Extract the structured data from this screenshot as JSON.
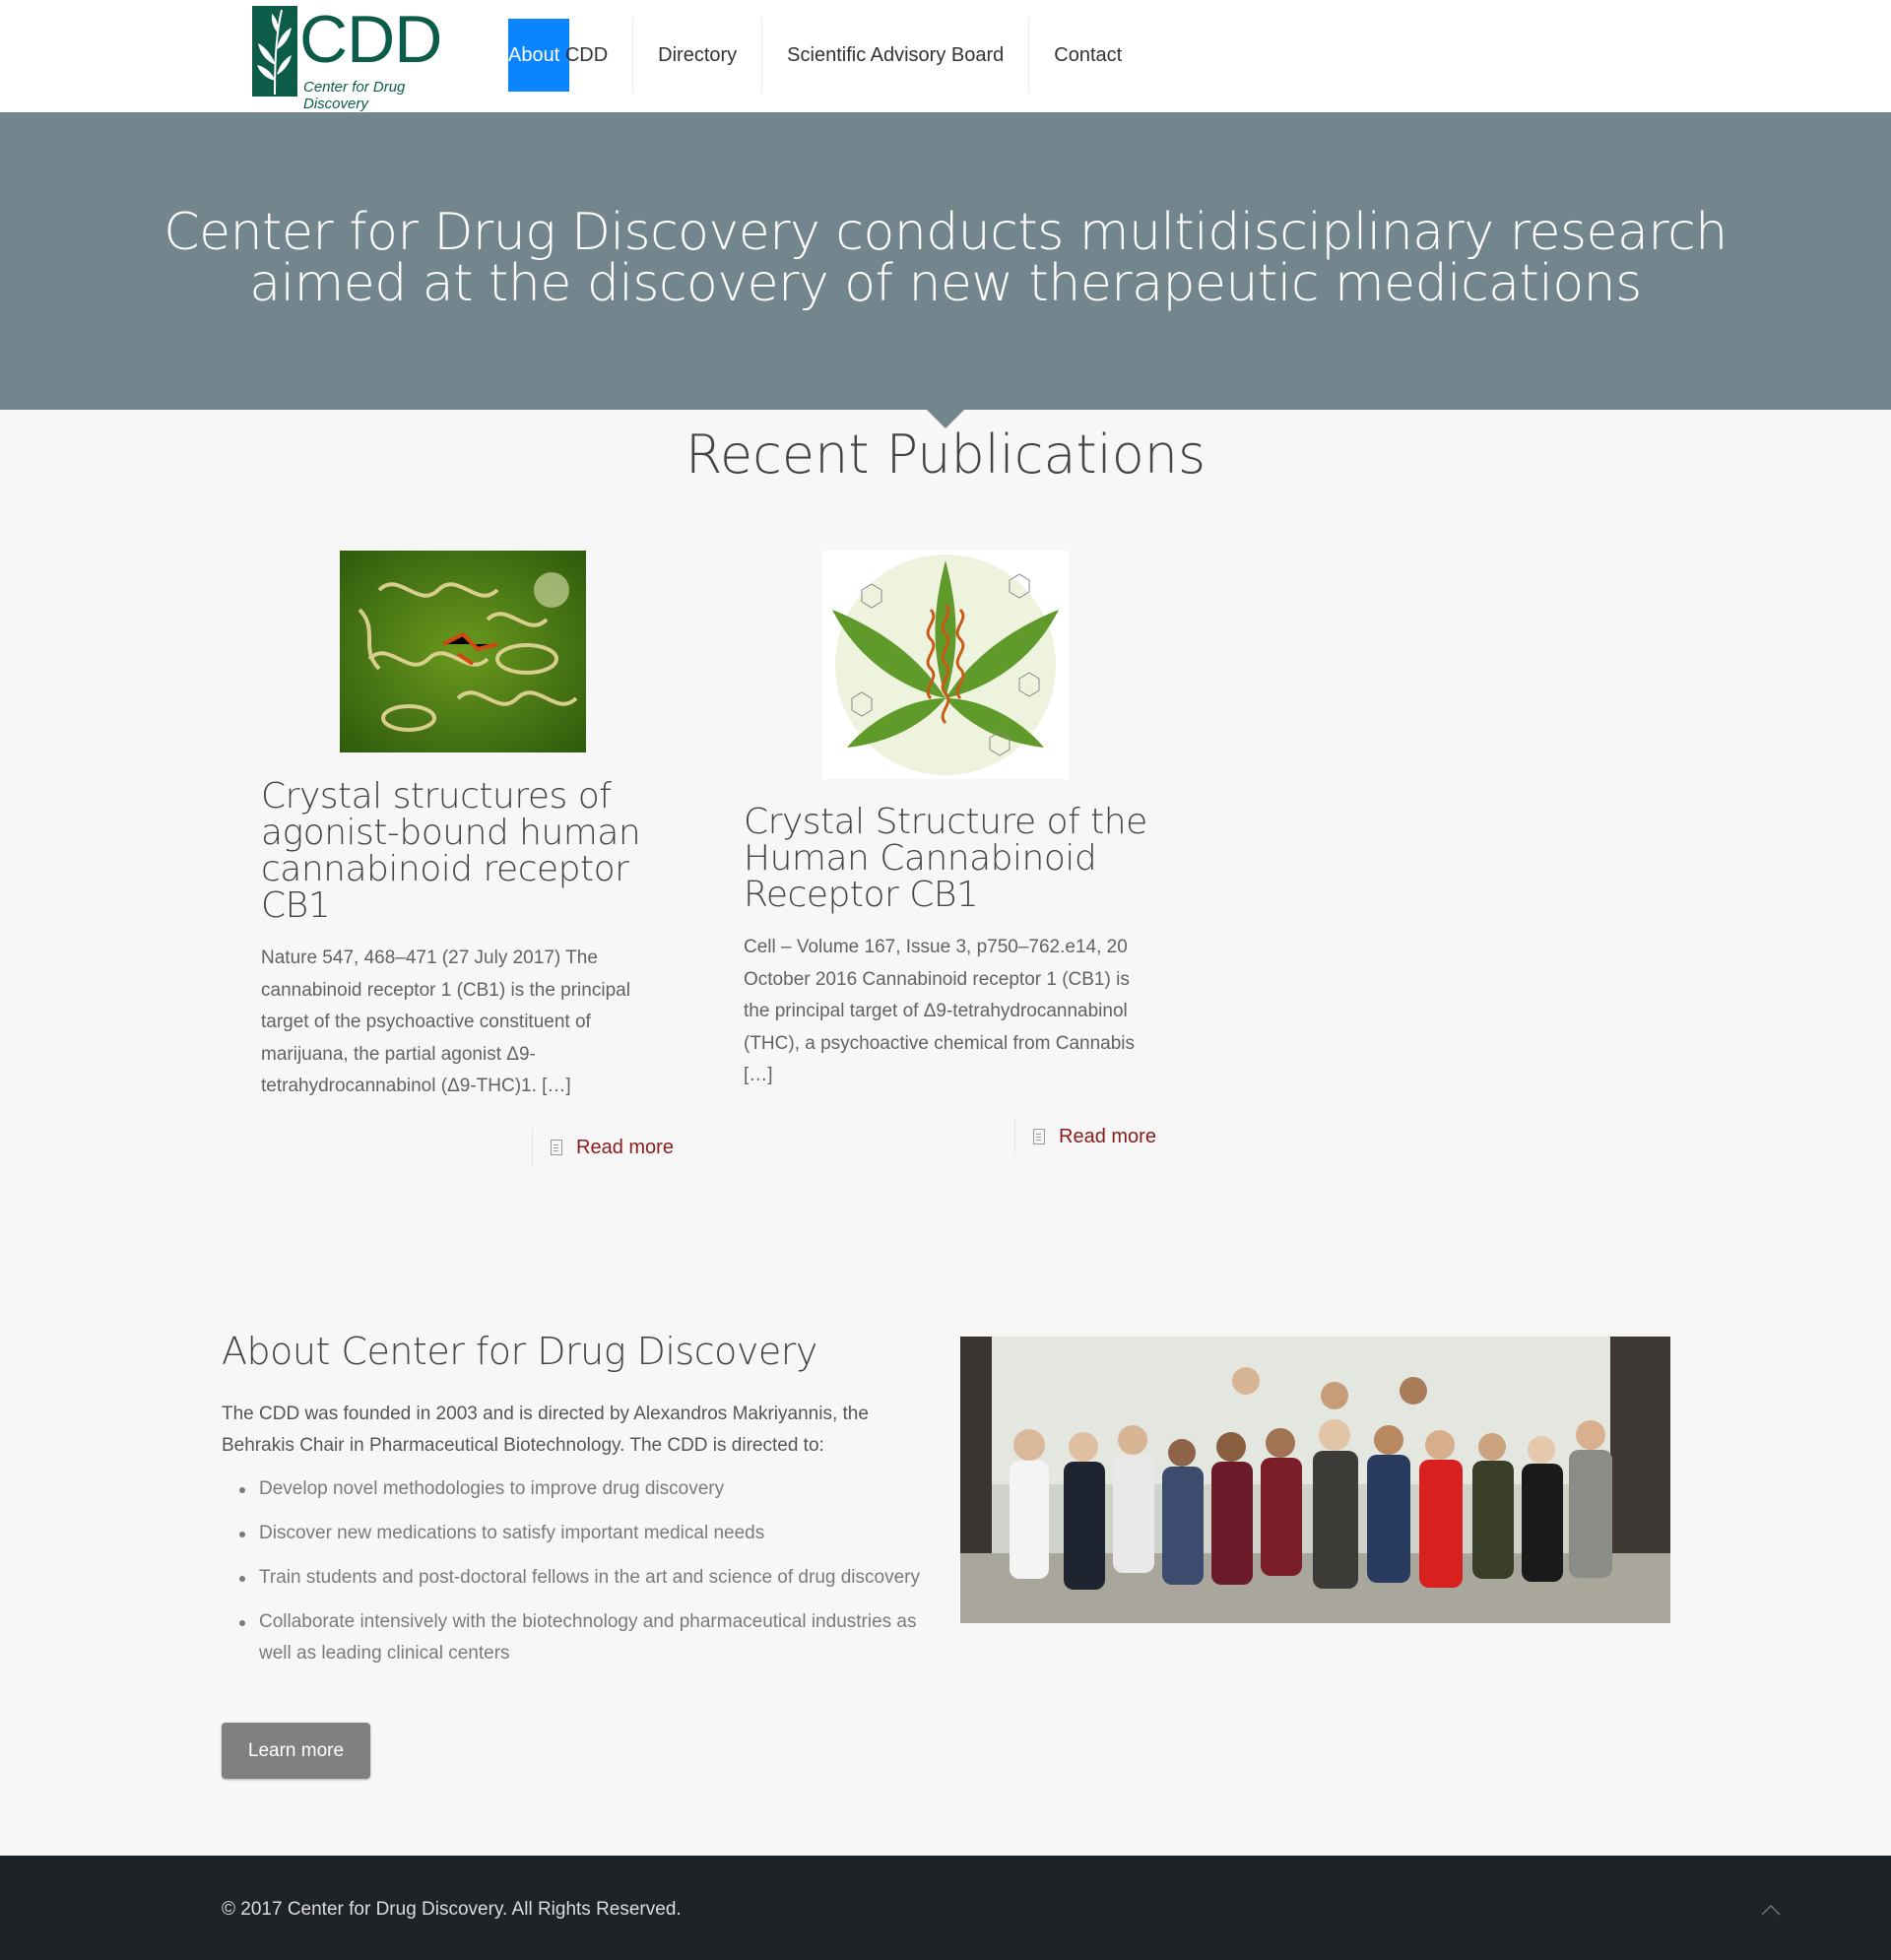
{
  "colors": {
    "hero_bg": "#74868d",
    "nav_highlight": "#0a84ff",
    "logo_green": "#0d5c4a",
    "readmore": "#8b1a1a",
    "footer_bg": "#1d2327",
    "button_bg": "#808080"
  },
  "header": {
    "logo": {
      "big_text": "CDD",
      "small_text": "Center for Drug Discovery",
      "icon": "leaf-logo-icon"
    },
    "nav": [
      {
        "label_highlight": "About",
        "label_rest": " CDD"
      },
      {
        "label": "Directory"
      },
      {
        "label": "Scientific Advisory Board"
      },
      {
        "label": "Contact"
      }
    ]
  },
  "hero": {
    "line1": "Center for Drug Discovery conducts multidisciplinary research",
    "line2": "aimed at the discovery of new therapeutic medications"
  },
  "publications": {
    "title": "Recent Publications",
    "items": [
      {
        "title": "Crystal structures of agonist-bound human cannabinoid receptor CB1",
        "excerpt": "Nature 547, 468–471 (27 July 2017) The cannabinoid receptor 1 (CB1) is the principal target of the psychoactive constituent of marijuana, the partial agonist Δ9-tetrahydrocannabinol (Δ9-THC)1. […]",
        "read_more": "Read more"
      },
      {
        "title": "Crystal Structure of the Human Cannabinoid Receptor CB1",
        "excerpt": "Cell – Volume 167, Issue 3, p750–762.e14, 20 October 2016 Cannabinoid receptor 1 (CB1) is the principal target of Δ9-tetrahydrocannabinol (THC), a psychoactive chemical from Cannabis […]",
        "read_more": "Read more"
      }
    ]
  },
  "about": {
    "title": "About Center for Drug Discovery",
    "intro": "The CDD was founded in 2003 and is directed by Alexandros Makriyannis, the Behrakis Chair in Pharmaceutical Biotechnology. The CDD is directed to:",
    "bullets": [
      "Develop novel methodologies to improve drug discovery",
      "Discover new medications to satisfy important medical needs",
      "Train students and post-doctoral fellows in the art and science of drug discovery",
      "Collaborate intensively with the biotechnology and pharmaceutical industries as well as leading clinical centers"
    ],
    "button": "Learn more"
  },
  "footer": {
    "copyright": "© 2017 Center for Drug Discovery. All Rights Reserved.",
    "back_to_top_icon": "chevron-up-icon"
  }
}
